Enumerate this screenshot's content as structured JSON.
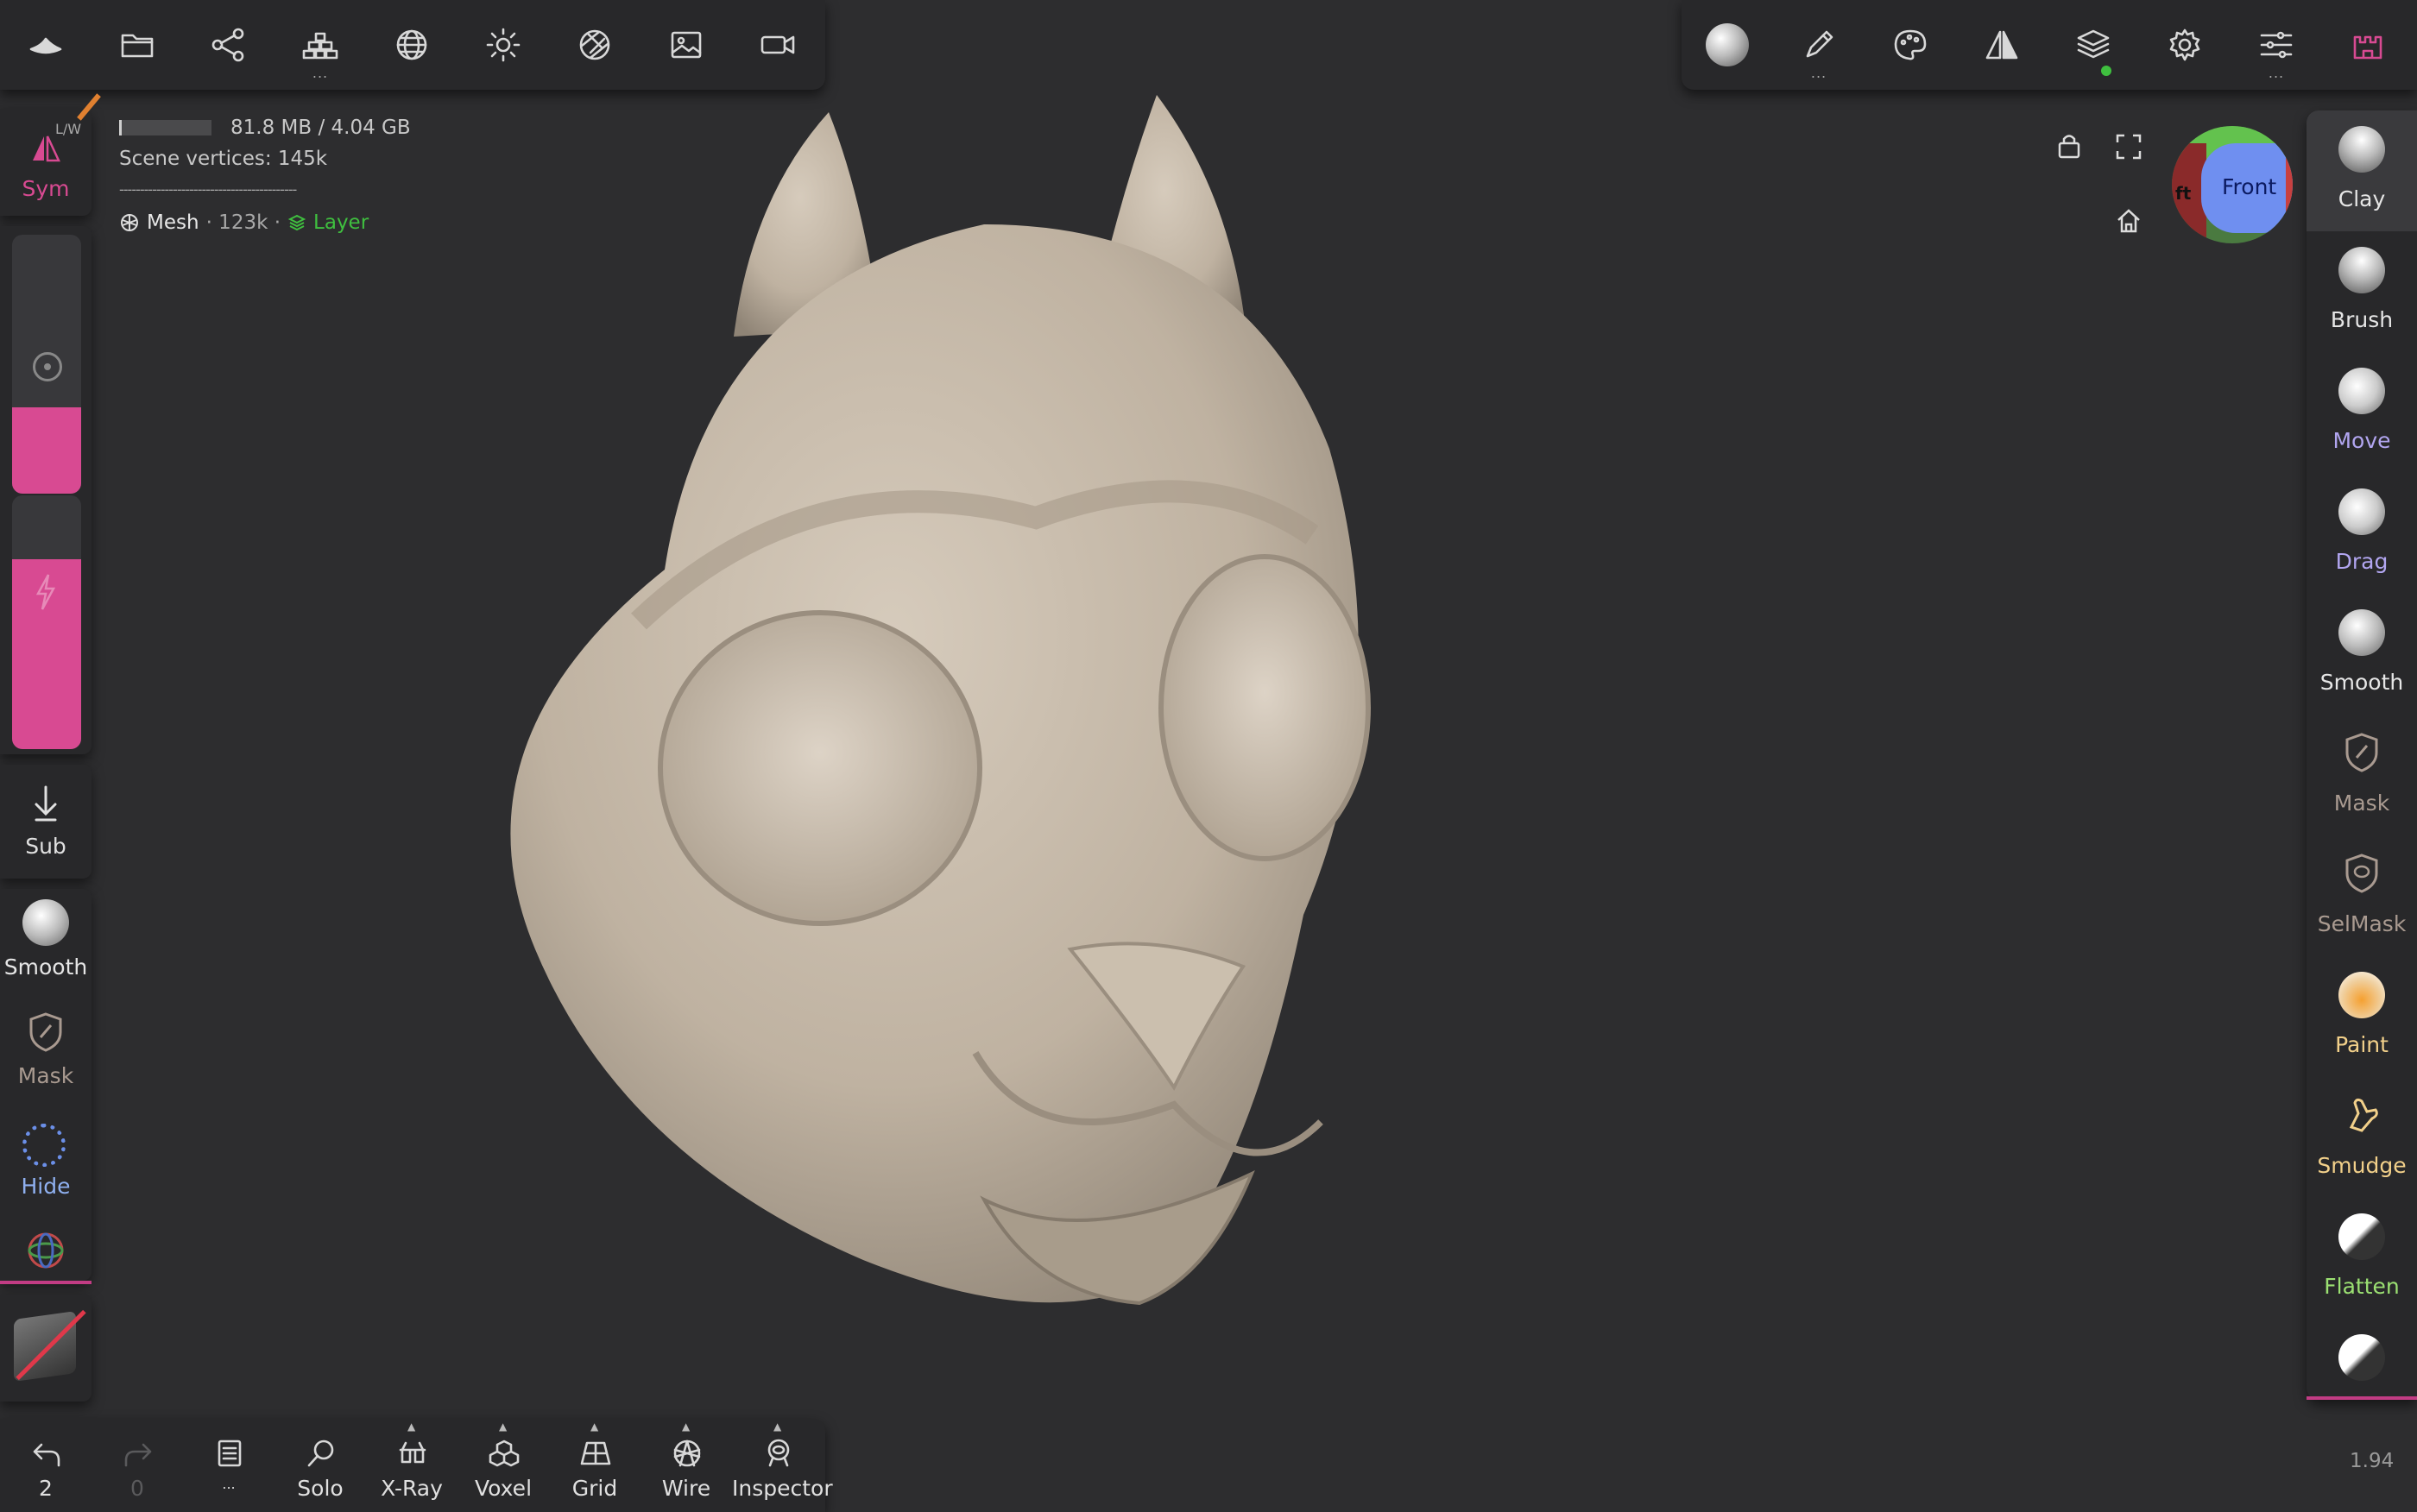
{
  "top_bar": {
    "tools": [
      "app-logo",
      "files",
      "scene-graph",
      "topology",
      "shading",
      "lighting",
      "material-render",
      "background",
      "video"
    ]
  },
  "top_right": {
    "tools": [
      "material-ball",
      "stroke",
      "palette",
      "symmetry",
      "layers",
      "settings",
      "interface"
    ]
  },
  "info": {
    "memory": "81.8 MB / 4.04 GB",
    "scene_vertices": "Scene vertices:  145k",
    "separator": "-------------------------------------------",
    "mesh_label": "Mesh",
    "mesh_count": "· 123k ·",
    "layer_label": "Layer"
  },
  "left": {
    "sym_label": "Sym",
    "sym_hint": "L/W",
    "sub_label": "Sub",
    "smooth_label": "Smooth",
    "mask_label": "Mask",
    "hide_label": "Hide"
  },
  "right_tools": [
    {
      "label": "Clay",
      "color": "#e6e6e6"
    },
    {
      "label": "Brush",
      "color": "#e6e6e6"
    },
    {
      "label": "Move",
      "color": "#b2a6f0"
    },
    {
      "label": "Drag",
      "color": "#b2a6f0"
    },
    {
      "label": "Smooth",
      "color": "#e6e6e6"
    },
    {
      "label": "Mask",
      "color": "#a99a90"
    },
    {
      "label": "SelMask",
      "color": "#a99a90"
    },
    {
      "label": "Paint",
      "color": "#f2d08a"
    },
    {
      "label": "Smudge",
      "color": "#f2d08a"
    },
    {
      "label": "Flatten",
      "color": "#9be072"
    }
  ],
  "bottom": {
    "undo_count": "2",
    "redo_count": "0",
    "solo": "Solo",
    "xray": "X-Ray",
    "voxel": "Voxel",
    "grid": "Grid",
    "wire": "Wire",
    "inspector": "Inspector",
    "ellipsis": "..."
  },
  "gizmo": {
    "front_label": "Front",
    "left_label": "ft"
  },
  "version": "1.94",
  "colors": {
    "accent_pink": "#d84a92",
    "layer_green": "#3fbf3f",
    "model": "#c6b9a8",
    "background": "#2d2d2f"
  }
}
